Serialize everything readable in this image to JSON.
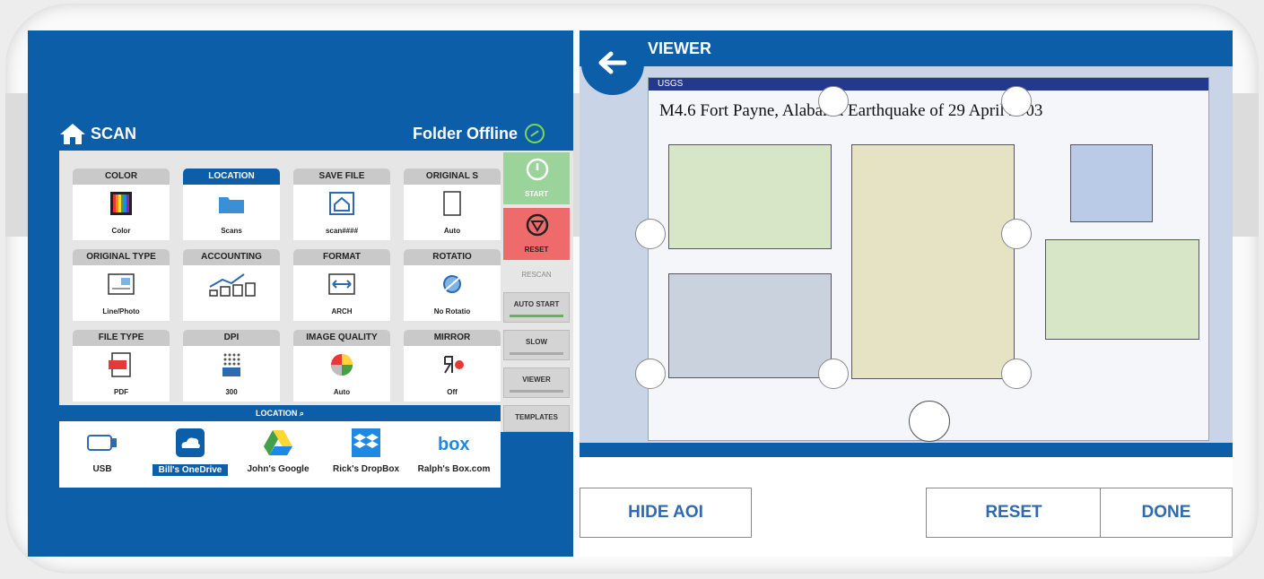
{
  "scan": {
    "title": "SCAN",
    "folder_status": "Folder Offline",
    "tiles": [
      {
        "label": "COLOR",
        "value": "Color",
        "icon": "color-swatch-icon"
      },
      {
        "label": "LOCATION",
        "value": "Scans",
        "icon": "folder-icon",
        "active": true
      },
      {
        "label": "SAVE FILE",
        "value": "scan####",
        "icon": "save-file-icon"
      },
      {
        "label": "ORIGINAL S",
        "value": "Auto",
        "icon": "page-size-icon"
      },
      {
        "label": "ORIGINAL TYPE",
        "value": "Line/Photo",
        "icon": "line-photo-icon"
      },
      {
        "label": "ACCOUNTING",
        "value": "",
        "icon": "accounting-icon"
      },
      {
        "label": "FORMAT",
        "value": "ARCH",
        "icon": "format-icon"
      },
      {
        "label": "ROTATIO",
        "value": "No Rotatio",
        "icon": "rotation-icon"
      },
      {
        "label": "FILE TYPE",
        "value": "PDF",
        "icon": "pdf-icon"
      },
      {
        "label": "DPI",
        "value": "300",
        "icon": "dpi-icon"
      },
      {
        "label": "IMAGE QUALITY",
        "value": "Auto",
        "icon": "image-quality-icon"
      },
      {
        "label": "MIRROR",
        "value": "Off",
        "icon": "mirror-icon"
      }
    ],
    "side_buttons": {
      "start": "START",
      "reset": "RESET",
      "rescan": "RESCAN",
      "auto_start": "AUTO START",
      "slow": "SLOW",
      "viewer": "VIEWER",
      "templates": "TEMPLATES"
    },
    "location_bar": "LOCATION",
    "destinations": [
      {
        "label": "USB",
        "icon": "usb-icon"
      },
      {
        "label": "Bill's OneDrive",
        "icon": "onedrive-icon",
        "selected": true
      },
      {
        "label": "John's Google",
        "icon": "google-drive-icon"
      },
      {
        "label": "Rick's DropBox",
        "icon": "dropbox-icon"
      },
      {
        "label": "Ralph's Box.com",
        "icon": "box-icon"
      }
    ],
    "colors": {
      "brand": "#0d5ea8",
      "start": "#9bd49b",
      "reset": "#ef6b6b"
    }
  },
  "viewer": {
    "title": "VIEWER",
    "poster_header": "USGS",
    "poster_title": "M4.6 Fort Payne, Alabama Earthquake of 29 April 2003",
    "buttons": {
      "hide_aoi": "HIDE AOI",
      "reset": "RESET",
      "done": "DONE"
    }
  }
}
